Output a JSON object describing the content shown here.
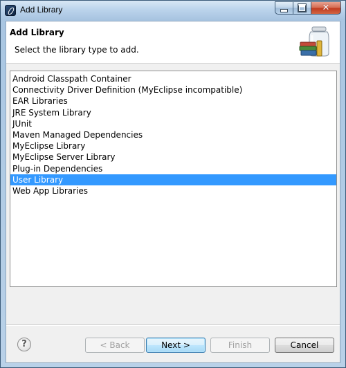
{
  "window": {
    "title": "Add Library"
  },
  "header": {
    "title": "Add Library",
    "description": "Select the library type to add.",
    "banner_icon": "library-jars-books-icon"
  },
  "library_list": {
    "items": [
      "Android Classpath Container",
      "Connectivity Driver Definition (MyEclipse incompatible)",
      "EAR Libraries",
      "JRE System Library",
      "JUnit",
      "Maven Managed Dependencies",
      "MyEclipse Library",
      "MyEclipse Server Library",
      "Plug-in Dependencies",
      "User Library",
      "Web App Libraries"
    ],
    "selected": "User Library"
  },
  "buttons": {
    "help": "?",
    "back": "< Back",
    "next": "Next >",
    "finish": "Finish",
    "cancel": "Cancel"
  },
  "colors": {
    "selection": "#3399ff",
    "title_bar": "#bcd4ec",
    "close_button": "#c03a1e"
  }
}
